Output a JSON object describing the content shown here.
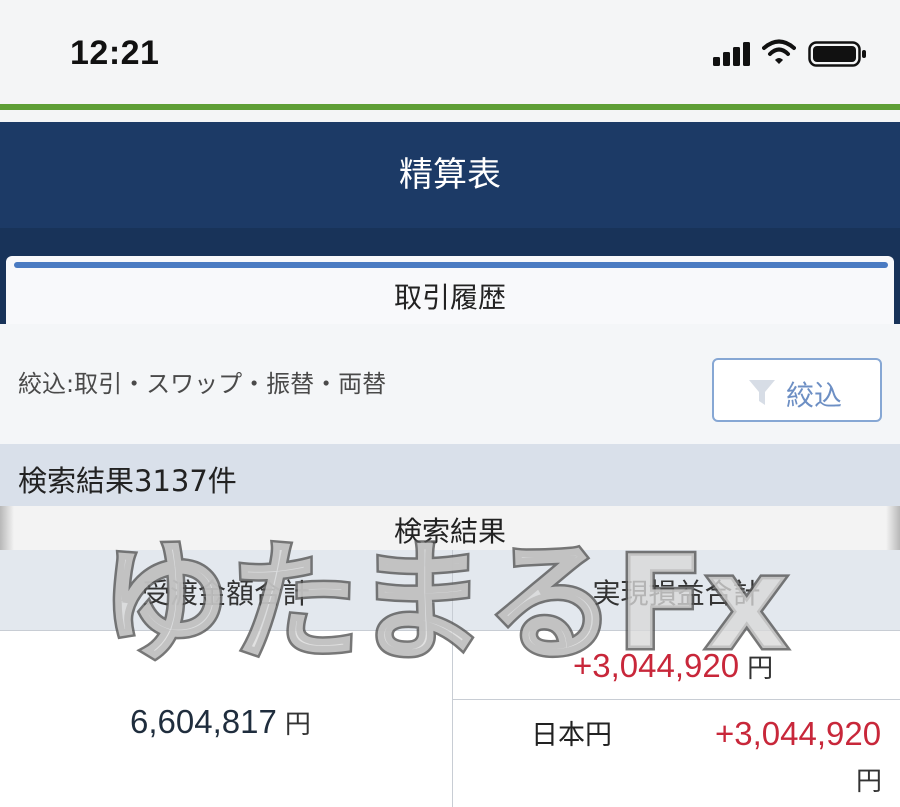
{
  "status_bar": {
    "time": "12:21"
  },
  "header": {
    "title": "精算表"
  },
  "tabs": [
    {
      "label": "取引履歴",
      "active": true
    }
  ],
  "filter": {
    "summary": "絞込:取引・スワップ・振替・両替",
    "button_label": "絞込"
  },
  "results": {
    "count_text": "検索結果3137件",
    "header_label": "検索結果"
  },
  "table": {
    "col_settlement": "受渡金額合計",
    "col_pl": "実現損益合計",
    "settlement_value": "6,604,817",
    "settlement_unit": "円",
    "pl_total_value": "+3,044,920",
    "pl_total_unit": "円",
    "currency_rows": [
      {
        "currency": "日本円",
        "value": "+3,044,920",
        "unit": "円"
      }
    ]
  },
  "watermark": {
    "text": "ゆたまるFx"
  },
  "colors": {
    "header_bg": "#1c3a66",
    "accent_green": "#5e9e36",
    "positive_red": "#c8273a",
    "filter_blue": "#6d8fc4"
  }
}
